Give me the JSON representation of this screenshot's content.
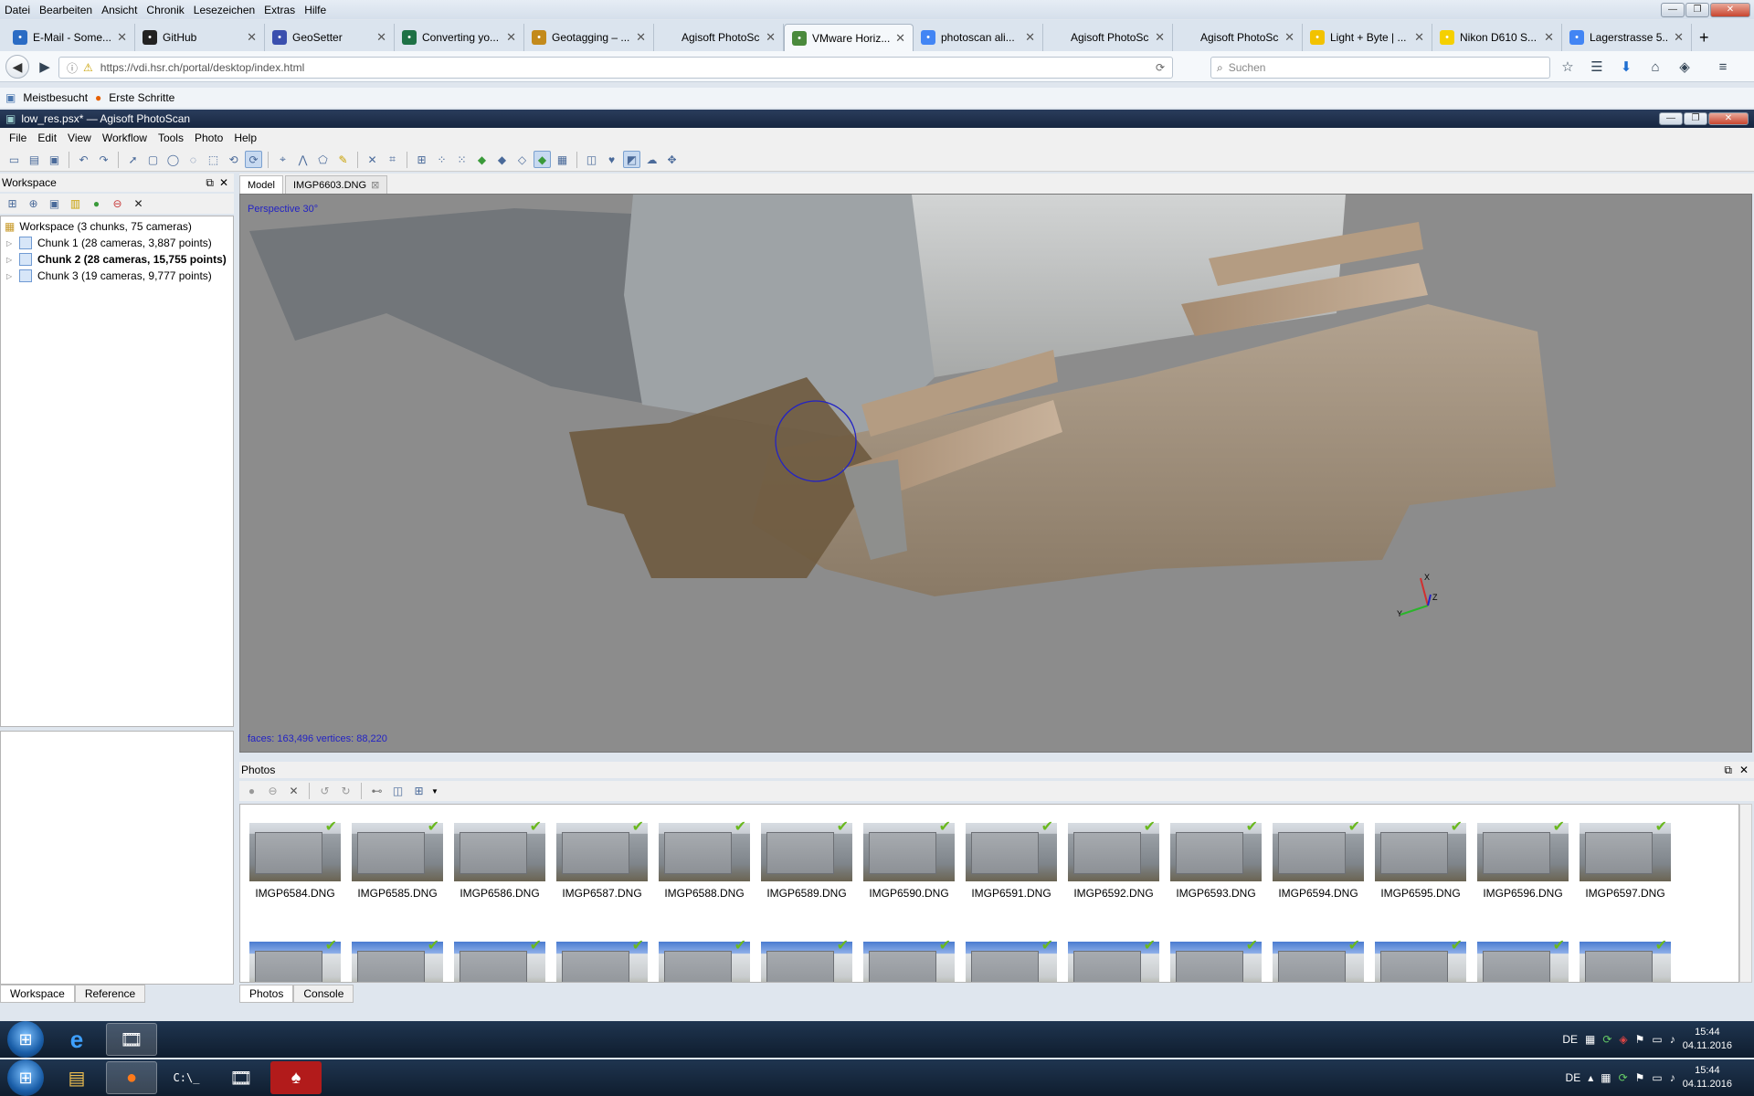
{
  "firefox": {
    "menu": [
      "Datei",
      "Bearbeiten",
      "Ansicht",
      "Chronik",
      "Lesezeichen",
      "Extras",
      "Hilfe"
    ],
    "tabs": [
      {
        "label": "E-Mail - Some...",
        "icon": "mail-icon",
        "color": "#2b6cc4"
      },
      {
        "label": "GitHub",
        "icon": "github-icon",
        "color": "#222222"
      },
      {
        "label": "GeoSetter",
        "icon": "geosetter-icon",
        "color": "#3a4fae"
      },
      {
        "label": "Converting yo...",
        "icon": "excel-icon",
        "color": "#1e7145"
      },
      {
        "label": "Geotagging – ...",
        "icon": "camera-icon",
        "color": "#c38a1b"
      },
      {
        "label": "Agisoft PhotoSca...",
        "icon": "",
        "color": ""
      },
      {
        "label": "VMware Horiz...",
        "icon": "vmware-icon",
        "color": "#4a8a3c"
      },
      {
        "label": "photoscan ali...",
        "icon": "google-icon",
        "color": "#4285f4"
      },
      {
        "label": "Agisoft PhotoSca...",
        "icon": "",
        "color": ""
      },
      {
        "label": "Agisoft PhotoSca...",
        "icon": "",
        "color": ""
      },
      {
        "label": "Light + Byte | ...",
        "icon": "lightbyte-icon",
        "color": "#f2c200"
      },
      {
        "label": "Nikon D610 S...",
        "icon": "nikon-icon",
        "color": "#f5d000"
      },
      {
        "label": "Lagerstrasse 5...",
        "icon": "google-icon",
        "color": "#4285f4"
      }
    ],
    "url": "https://vdi.hsr.ch/portal/desktop/index.html",
    "search_placeholder": "Suchen",
    "bookmarks": [
      "Meistbesucht",
      "Erste Schritte"
    ]
  },
  "photoscan": {
    "title": "low_res.psx* — Agisoft PhotoScan",
    "menu": [
      "File",
      "Edit",
      "View",
      "Workflow",
      "Tools",
      "Photo",
      "Help"
    ],
    "workspace": {
      "title": "Workspace",
      "root": "Workspace (3 chunks, 75 cameras)",
      "chunks": [
        "Chunk 1 (28 cameras, 3,887 points)",
        "Chunk 2 (28 cameras, 15,755 points)",
        "Chunk 3 (19 cameras, 9,777 points)"
      ],
      "tabs": [
        "Workspace",
        "Reference"
      ]
    },
    "model_tabs": [
      "Model",
      "IMGP6603.DNG"
    ],
    "viewport": {
      "projection": "Perspective 30°",
      "stats": "faces: 163,496 vertices: 88,220",
      "axes": [
        "X",
        "Y",
        "Z"
      ]
    },
    "photos": {
      "title": "Photos",
      "row1": [
        "IMGP6584.DNG",
        "IMGP6585.DNG",
        "IMGP6586.DNG",
        "IMGP6587.DNG",
        "IMGP6588.DNG",
        "IMGP6589.DNG",
        "IMGP6590.DNG",
        "IMGP6591.DNG",
        "IMGP6592.DNG",
        "IMGP6593.DNG",
        "IMGP6594.DNG",
        "IMGP6595.DNG",
        "IMGP6596.DNG",
        "IMGP6597.DNG"
      ],
      "tabs": [
        "Photos",
        "Console"
      ]
    }
  },
  "taskbar": {
    "lang": "DE",
    "time": "15:44",
    "date": "04.11.2016"
  }
}
